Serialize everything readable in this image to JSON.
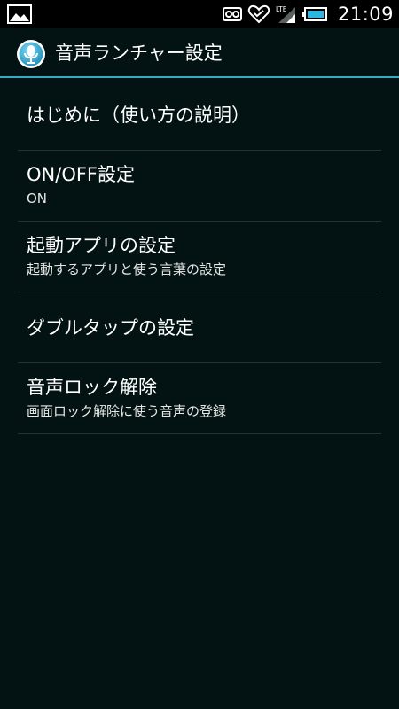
{
  "status_bar": {
    "left_icon": "image-icon",
    "icons": [
      "voicemail-icon",
      "heart-sync-icon",
      "lte-signal-icon",
      "battery-icon"
    ],
    "lte_label": "LTE",
    "time": "21:09"
  },
  "app_bar": {
    "icon": "microphone-icon",
    "title": "音声ランチャー設定",
    "accent_color": "#36a9c4"
  },
  "settings": {
    "items": [
      {
        "title": "はじめに（使い方の説明）",
        "subtitle": ""
      },
      {
        "title": "ON/OFF設定",
        "subtitle": "ON"
      },
      {
        "title": "起動アプリの設定",
        "subtitle": "起動するアプリと使う言葉の設定"
      },
      {
        "title": "ダブルタップの設定",
        "subtitle": ""
      },
      {
        "title": "音声ロック解除",
        "subtitle": "画面ロック解除に使う音声の登録"
      }
    ]
  }
}
